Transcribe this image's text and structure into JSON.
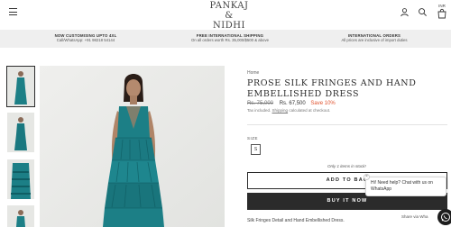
{
  "header": {
    "logo_line1": "PANKAJ",
    "logo_line2": "& NIDHI",
    "currency": "INR"
  },
  "infobar": {
    "items": [
      {
        "title": "NOW CUSTOMISING UPTO 4XL",
        "subtitle": "Call/WhatsApp: +91 98218 54144"
      },
      {
        "title": "FREE INTERNATIONAL SHIPPING",
        "subtitle": "On all orders worth Rs. 35,000/$500 & above"
      },
      {
        "title": "INTERNATIONAL ORDERS",
        "subtitle": "All prices are inclusive of import duties"
      }
    ]
  },
  "product": {
    "breadcrumb": "Home",
    "title": "PROSE SILK FRINGES AND HAND EMBELLISHED DRESS",
    "old_price": "Rs. 75,000",
    "new_price": "Rs. 67,500",
    "save": "Save 10%",
    "tax_prefix": "Tax included.",
    "tax_link": "Shipping",
    "tax_suffix": "calculated at checkout.",
    "size_label": "SIZE",
    "size_value": "S",
    "stock": "Only 1 items in stock!",
    "add_to_bag": "ADD TO BAG",
    "buy_now": "BUY IT NOW",
    "description": "Silk Fringes Detail and Hand Embellished Dress."
  },
  "chat": {
    "message": "Hi! Need help? Chat with us on WhatsApp",
    "close": "×",
    "share": "Share via Wha"
  },
  "colors": {
    "accent_save": "#e0522d",
    "dress": "#1c7f86",
    "button_dark": "#2b2b2b"
  }
}
